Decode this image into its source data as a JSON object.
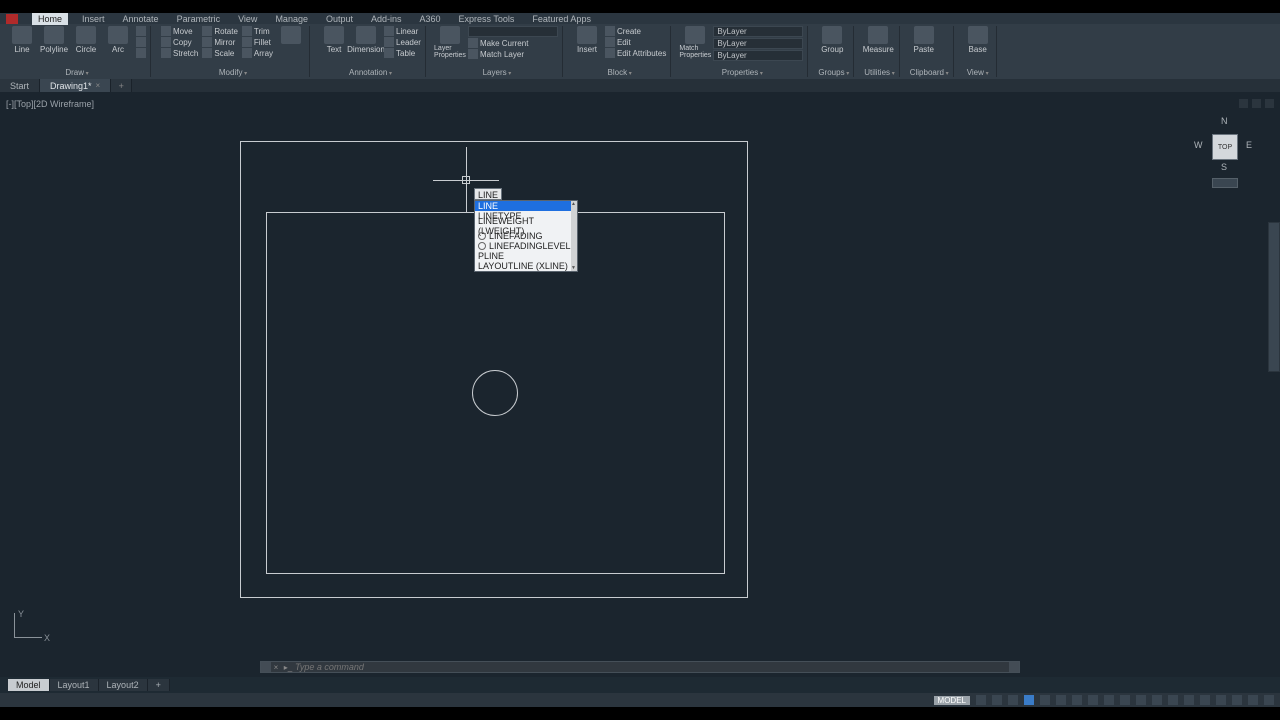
{
  "menubar": {
    "items": [
      "Home",
      "Insert",
      "Annotate",
      "Parametric",
      "View",
      "Manage",
      "Output",
      "Add-ins",
      "A360",
      "Express Tools",
      "Featured Apps"
    ],
    "active": "Home"
  },
  "ribbon": {
    "panels": [
      {
        "title": "Draw",
        "big": [
          {
            "label": "Line"
          },
          {
            "label": "Polyline"
          },
          {
            "label": "Circle"
          },
          {
            "label": "Arc"
          }
        ]
      },
      {
        "title": "Modify",
        "rows": [
          [
            "Move",
            "Rotate",
            "Trim"
          ],
          [
            "Copy",
            "Mirror",
            "Fillet"
          ],
          [
            "Stretch",
            "Scale",
            "Array"
          ]
        ]
      },
      {
        "title": "Annotation",
        "big": [
          {
            "label": "Text"
          },
          {
            "label": "Dimension"
          }
        ],
        "rows": [
          [
            "Linear"
          ],
          [
            "Leader"
          ],
          [
            "Table"
          ]
        ]
      },
      {
        "title": "Layers",
        "big": [
          {
            "label": "Layer Properties"
          }
        ],
        "rows": [
          [
            "Make Current"
          ],
          [
            "Match Layer"
          ]
        ]
      },
      {
        "title": "Block",
        "big": [
          {
            "label": "Insert"
          }
        ],
        "rows": [
          [
            "Create"
          ],
          [
            "Edit"
          ],
          [
            "Edit Attributes"
          ]
        ]
      },
      {
        "title": "Properties",
        "big": [
          {
            "label": "Match Properties"
          }
        ],
        "drops": [
          "ByLayer",
          "ByLayer",
          "ByLayer"
        ]
      },
      {
        "title": "Groups",
        "big": [
          {
            "label": "Group"
          }
        ]
      },
      {
        "title": "Utilities",
        "big": [
          {
            "label": "Measure"
          }
        ]
      },
      {
        "title": "Clipboard",
        "big": [
          {
            "label": "Paste"
          }
        ]
      },
      {
        "title": "View",
        "big": [
          {
            "label": "Base"
          }
        ]
      }
    ]
  },
  "doctabs": {
    "start": "Start",
    "active": "Drawing1*"
  },
  "viewport": {
    "label": "[-][Top][2D Wireframe]",
    "dyn_input": "LINE",
    "suggestions": [
      {
        "label": "LINE",
        "sel": true
      },
      {
        "label": "LINETYPE"
      },
      {
        "label": "LINEWEIGHT (LWEIGHT)"
      },
      {
        "label": "LINEFADING",
        "sys": true
      },
      {
        "label": "LINEFADINGLEVEL",
        "sys": true
      },
      {
        "label": "PLINE"
      },
      {
        "label": "LAYOUTLINE (XLINE)"
      }
    ],
    "viewcube": {
      "face": "TOP",
      "n": "N",
      "s": "S",
      "e": "E",
      "w": "W"
    },
    "ucs": {
      "x": "X",
      "y": "Y"
    }
  },
  "cmdline": {
    "placeholder": "Type a command"
  },
  "layouttabs": {
    "items": [
      "Model",
      "Layout1",
      "Layout2"
    ],
    "active": "Model"
  },
  "status": {
    "mode": "MODEL"
  }
}
